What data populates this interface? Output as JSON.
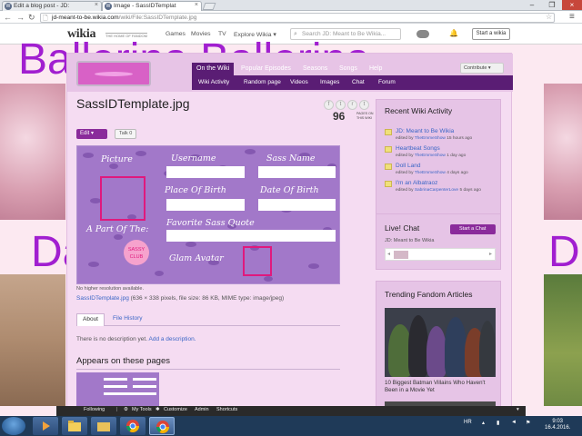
{
  "browser": {
    "tabs": [
      {
        "label": "Edit a blog post - JD:"
      },
      {
        "label": "Image - SassIDTemplat"
      }
    ],
    "address": {
      "domain": "jd-meant-to-be.wikia.com",
      "path": "/wiki/File:SassIDTemplate.jpg"
    }
  },
  "wikia_bar": {
    "logo": "wikia",
    "tagline": "THE HOME OF FANDOM",
    "nav": [
      "Games",
      "Movies",
      "TV",
      "Explore Wikia ▾"
    ],
    "search_placeholder": "Search JD: Meant to Be Wikia...",
    "start_label": "Start a wikia"
  },
  "background": {
    "line1": "Ballerina     Ballerina",
    "line2": "Da",
    "line3": "D"
  },
  "wiki_nav": {
    "tabs": [
      "On the Wiki",
      "Popular Episodes",
      "Seasons",
      "Songs",
      "Help"
    ],
    "contribute": "Contribute ▾",
    "sub": [
      "Wiki Activity",
      "Random page",
      "Videos",
      "Images",
      "Chat",
      "Forum"
    ]
  },
  "page": {
    "title": "SassIDTemplate.jpg",
    "page_count": "96",
    "page_count_label": "PAGES ON THIS WIKI",
    "edit_label": "Edit ▾",
    "talk_label": "Talk 0",
    "image_text": {
      "picture": "Picture",
      "username": "Username",
      "sass_name": "Sass Name",
      "place_of_birth": "Place Of Birth",
      "date_of_birth": "Date Of Birth",
      "part_of": "A Part Of The:",
      "fav_quote": "Favorite Sass Quote",
      "glam_avatar": "Glam Avatar",
      "heart_text": "SASSY CLUB"
    },
    "no_higher": "No higher resolution available.",
    "file_link": "SassIDTemplate.jpg",
    "file_meta": " (636 × 338 pixels, file size: 86 KB, MIME type: image/jpeg)",
    "tabs": [
      "About",
      "File History"
    ],
    "desc_text": "There is no description yet.",
    "desc_link": "Add a description.",
    "appears_title": "Appears on these pages"
  },
  "rail": {
    "activity_title": "Recent Wiki Activity",
    "activity": [
      {
        "title": "JD: Meant to Be Wikia",
        "by": "TheEmmeShow",
        "when": "15 hours ago"
      },
      {
        "title": "Heartbeat Songs",
        "by": "TheEmmeShow",
        "when": "1 day ago"
      },
      {
        "title": "Doll Land",
        "by": "TheEmmeShow",
        "when": "4 days ago"
      },
      {
        "title": "I'm an Albatraoz",
        "by": "SabrinaCarpenterLove",
        "when": "5 days ago"
      }
    ],
    "edited_by": "edited by",
    "see_more": "See more >",
    "chat_title": "Live! Chat",
    "start_chat": "Start a Chat",
    "chat_sub": "JD: Meant to Be Wikia",
    "trending_title": "Trending Fandom Articles",
    "trending_caption": "10 Biggest Batman Villains Who Haven't Been in a Movie Yet"
  },
  "wiki_toolbar": [
    "Following",
    "My Tools",
    "Customize",
    "Admin",
    "Shortcuts"
  ],
  "taskbar": {
    "lang": "HR",
    "time": "9:03",
    "date": "16.4.2016."
  }
}
